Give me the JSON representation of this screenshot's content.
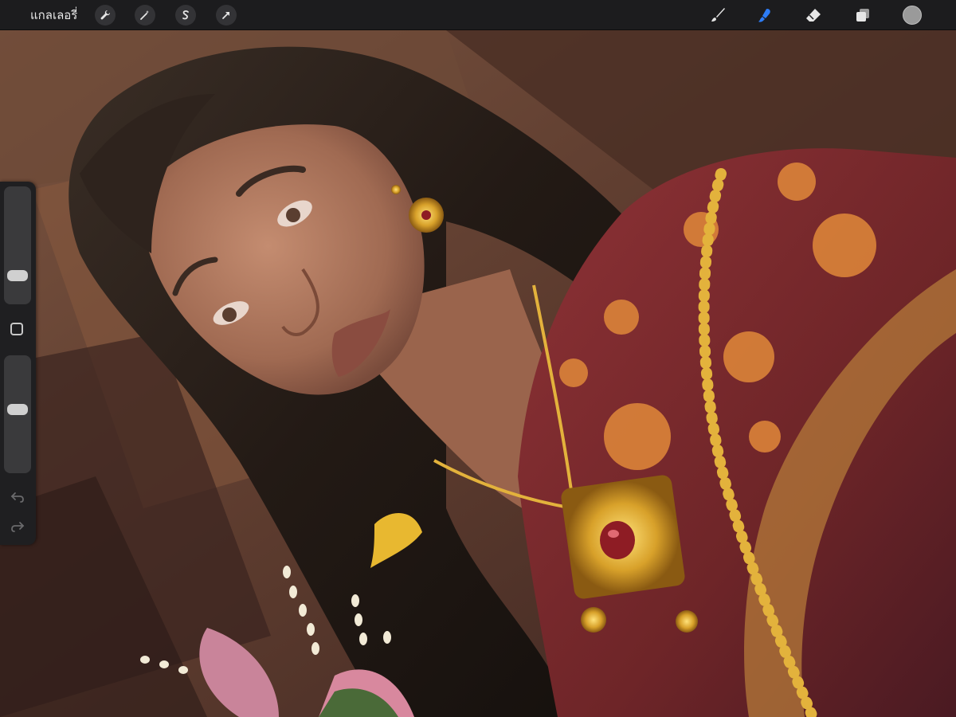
{
  "toolbar": {
    "gallery_label": "แกลเลอรี่",
    "left_tools": [
      "wrench-icon",
      "magic-wand-icon",
      "selection-icon",
      "transform-arrow-icon"
    ],
    "right_tools": [
      "brush-icon",
      "smudge-icon",
      "eraser-icon",
      "layers-icon"
    ],
    "active_tool": "smudge",
    "accent_color": "#2d7cf6",
    "current_color": "#9a9a9a"
  },
  "sidebar": {
    "brush_size": 0.2,
    "opacity": 0.55,
    "buttons": [
      "modify-button",
      "undo-icon",
      "redo-icon"
    ]
  },
  "canvas": {
    "description_colors": {
      "background": "#5a3a2e",
      "hair": "#2b211b",
      "skin": "#a6735a",
      "fabric": "#7a2a2c",
      "gold": "#d8a12a"
    }
  }
}
